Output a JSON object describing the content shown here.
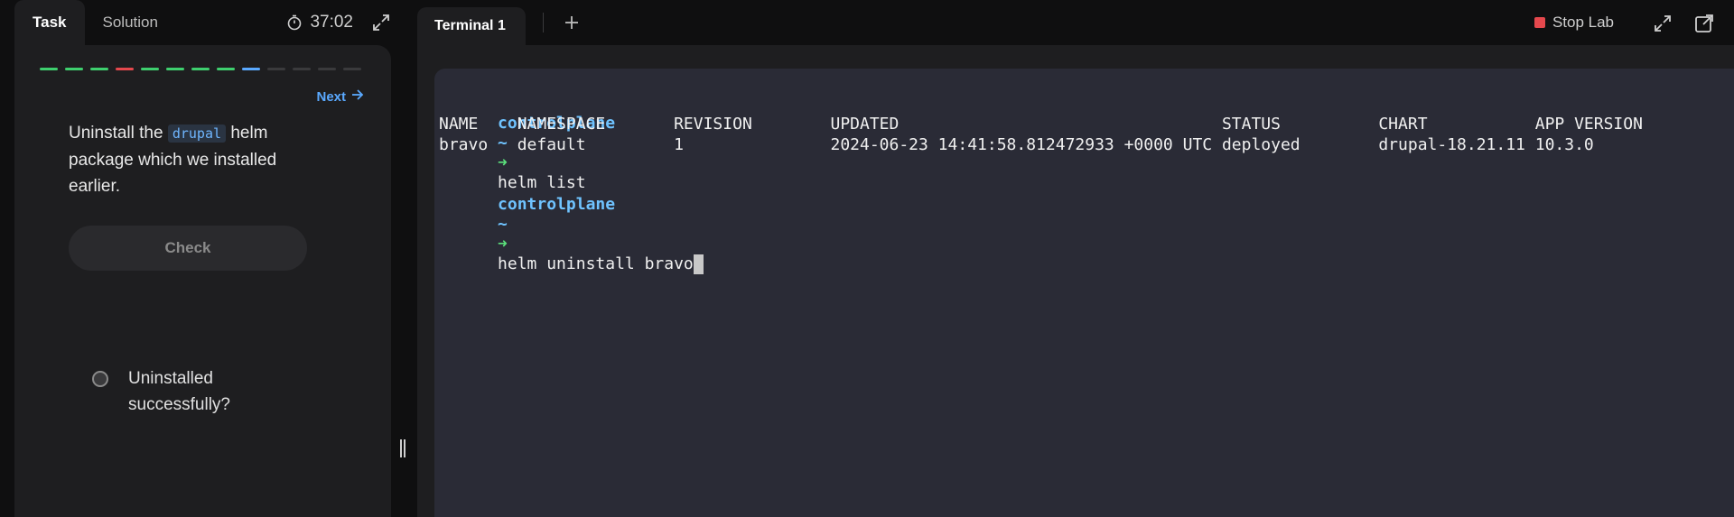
{
  "left": {
    "tabs": [
      {
        "label": "Task"
      },
      {
        "label": "Solution"
      }
    ],
    "timer": "37:02",
    "progress_colors": [
      "#3ecf6e",
      "#3ecf6e",
      "#3ecf6e",
      "#e5484d",
      "#3ecf6e",
      "#3ecf6e",
      "#3ecf6e",
      "#3ecf6e",
      "#5aa9ff",
      "#3a3a3c",
      "#3a3a3c",
      "#3a3a3c",
      "#3a3a3c"
    ],
    "next_label": "Next",
    "step": "9 / 13",
    "question": {
      "before": "Uninstall the",
      "code": "drupal",
      "after": "helm package which we installed earlier."
    },
    "check_label": "Check",
    "checks": [
      {
        "label": "Uninstalled successfully?"
      }
    ]
  },
  "right": {
    "tab_label": "Terminal 1",
    "stop_label": "Stop Lab",
    "prompt": {
      "host": "controlplane",
      "tilde": "~",
      "arrow": "➜"
    },
    "cmd1": "helm list",
    "table_header": "NAME    NAMESPACE       REVISION        UPDATED                                 STATUS          CHART           APP VERSION",
    "table_row": "bravo   default         1               2024-06-23 14:41:58.812472933 +0000 UTC deployed        drupal-18.21.11 10.3.0",
    "cmd2": "helm uninstall bravo"
  }
}
